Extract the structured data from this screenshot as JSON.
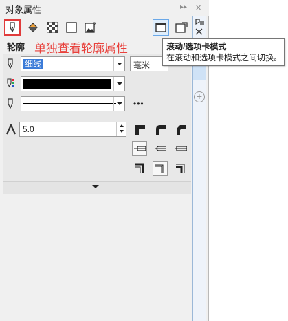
{
  "window": {
    "title": "对象属性",
    "title_buttons": [
      "▸▸",
      "✕"
    ]
  },
  "toolbar": {
    "tools": [
      {
        "name": "outline-tab",
        "icon": "pen-nib-icon",
        "selected": true
      },
      {
        "name": "fill-tab",
        "icon": "fill-bucket-icon"
      },
      {
        "name": "transparency-tab",
        "icon": "checkerboard-icon"
      },
      {
        "name": "frame-tab",
        "icon": "square-icon"
      },
      {
        "name": "image-tab",
        "icon": "image-question-icon"
      }
    ],
    "right_tools": [
      {
        "name": "scroll-tab-mode-button",
        "icon": "window-icon",
        "active": true
      },
      {
        "name": "single-view-button",
        "icon": "window-arrow-icon"
      },
      {
        "name": "settings-list-button",
        "icon": "list-settings-icon"
      }
    ]
  },
  "outline": {
    "section_label": "轮廓",
    "annotation": "单独查看轮廓属性",
    "width_value": "细线",
    "unit_value": "毫米",
    "color_hex": "#000000",
    "style": "solid",
    "more_label": "•••",
    "miter_value": "5.0",
    "corner_options": [
      "miter-corner-icon",
      "round-corner-icon",
      "bevel-corner-icon"
    ],
    "cap_options": [
      "butt-cap-icon",
      "round-cap-icon",
      "square-cap-icon"
    ],
    "position_options": [
      "outside-position-icon",
      "center-position-icon",
      "inside-position-icon"
    ]
  },
  "tooltip": {
    "title": "滚动/选项卡模式",
    "description": "在滚动和选项卡模式之间切换。"
  },
  "colors": {
    "annotation": "#e8413c",
    "selection_highlight": "#3b7bd8",
    "active_border": "#6aa8e8"
  }
}
